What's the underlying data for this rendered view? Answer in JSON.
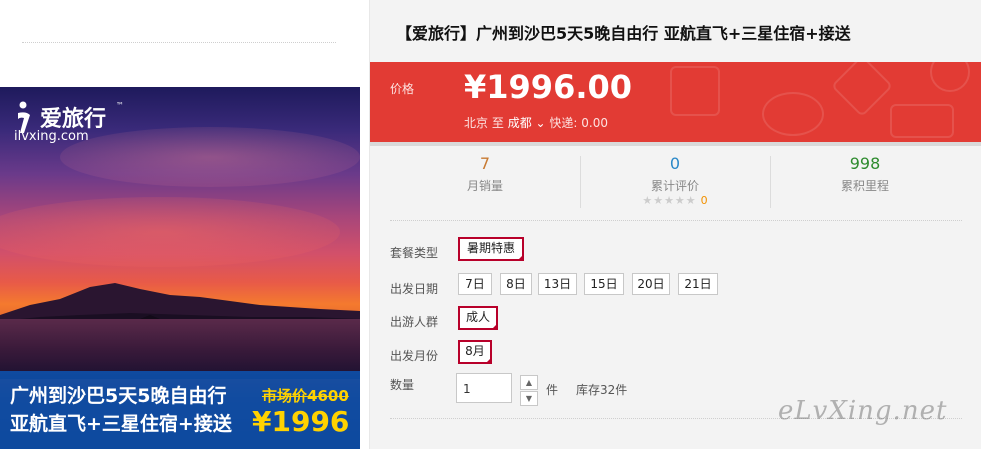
{
  "product": {
    "title": "【爱旅行】广州到沙巴5天5晚自由行 亚航直飞+三星住宿+接送"
  },
  "image": {
    "logo_text": "爱旅行",
    "logo_tm": "™",
    "logo_domain": "ilvxing.com",
    "banner_line1": "广州到沙巴5天5晚自由行",
    "banner_line2": "亚航直飞+三星住宿+接送",
    "market_price_label": "市场价",
    "market_price_value": "4600",
    "banner_price": "¥1996"
  },
  "price": {
    "label": "价格",
    "value": "¥1996.00",
    "origin": "北京",
    "to": "至",
    "destination": "成都",
    "shipping_label": "快递:",
    "shipping_value": "0.00"
  },
  "stats": {
    "monthly_sales": {
      "value": "7",
      "label": "月销量"
    },
    "reviews": {
      "value": "0",
      "label": "累计评价",
      "stars": "★★★★★",
      "star_count": "0"
    },
    "points": {
      "value": "998",
      "label": "累积里程"
    }
  },
  "options": {
    "package_label": "套餐类型",
    "package_items": [
      "暑期特惠"
    ],
    "date_label": "出发日期",
    "date_items": [
      "7日",
      "8日",
      "13日",
      "15日",
      "20日",
      "21日"
    ],
    "crowd_label": "出游人群",
    "crowd_items": [
      "成人"
    ],
    "month_label": "出发月份",
    "month_items": [
      "8月"
    ],
    "qty_label": "数量",
    "qty_value": "1",
    "qty_unit": "件",
    "stock_text": "库存32件",
    "spin_up": "▲",
    "spin_down": "▼"
  },
  "watermark": "eLvXing.net",
  "colors": {
    "price_bar": "#e23b34",
    "selected_border": "#b8002a",
    "sales_color": "#c87a32",
    "reviews_color": "#2a88c8",
    "points_color": "#2e8b2e",
    "banner_bg": "#0a5abe",
    "banner_price": "#ffd200"
  }
}
